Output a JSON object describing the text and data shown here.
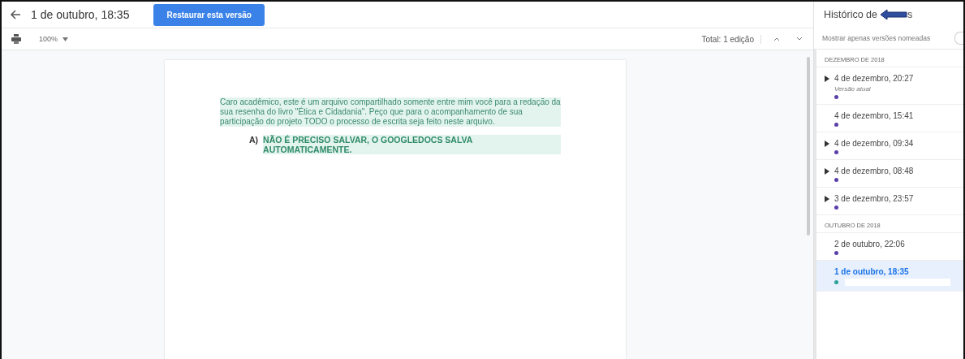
{
  "header": {
    "title": "1 de outubro, 18:35",
    "restore_button": "Restaurar esta versão"
  },
  "toolbar": {
    "zoom": "100%",
    "total": "Total: 1 edição"
  },
  "document": {
    "paragraph": "Caro acadêmico, este é um arquivo compartilhado somente entre mim você para a redação da sua resenha do livro \"Ética e Cidadania\". Peço que para o acompanhamento de sua participação do projeto TODO o processo de escrita seja feito neste arquivo.",
    "list_marker": "A)",
    "list_item": "NÃO É PRECISO SALVAR, O GOOGLEDOCS SALVA AUTOMATICAMENTE."
  },
  "sidebar": {
    "title_start": "Histórico de",
    "title_end": "s",
    "filter_label": "Mostrar apenas versões nomeadas",
    "filter_on": false,
    "groups": [
      {
        "heading": "DEZEMBRO DE 2018",
        "items": [
          {
            "label": "4 de dezembro, 20:27",
            "subtitle": "Versão atual",
            "expandable": true,
            "color": "#5b3fa8",
            "selected": false
          },
          {
            "label": "4 de dezembro, 15:41",
            "expandable": false,
            "color": "#5b3fa8",
            "selected": false
          },
          {
            "label": "4 de dezembro, 09:34",
            "expandable": true,
            "color": "#5b3fa8",
            "selected": false
          },
          {
            "label": "4 de dezembro, 08:48",
            "expandable": true,
            "color": "#5b3fa8",
            "selected": false
          },
          {
            "label": "3 de dezembro, 23:57",
            "expandable": true,
            "color": "#5b3fa8",
            "selected": false
          }
        ]
      },
      {
        "heading": "OUTUBRO DE 2018",
        "items": [
          {
            "label": "2 de outubro, 22:06",
            "expandable": false,
            "color": "#5b3fa8",
            "selected": false
          },
          {
            "label": "1 de outubro, 18:35",
            "expandable": false,
            "color": "#2aa198",
            "selected": true
          }
        ]
      }
    ]
  }
}
